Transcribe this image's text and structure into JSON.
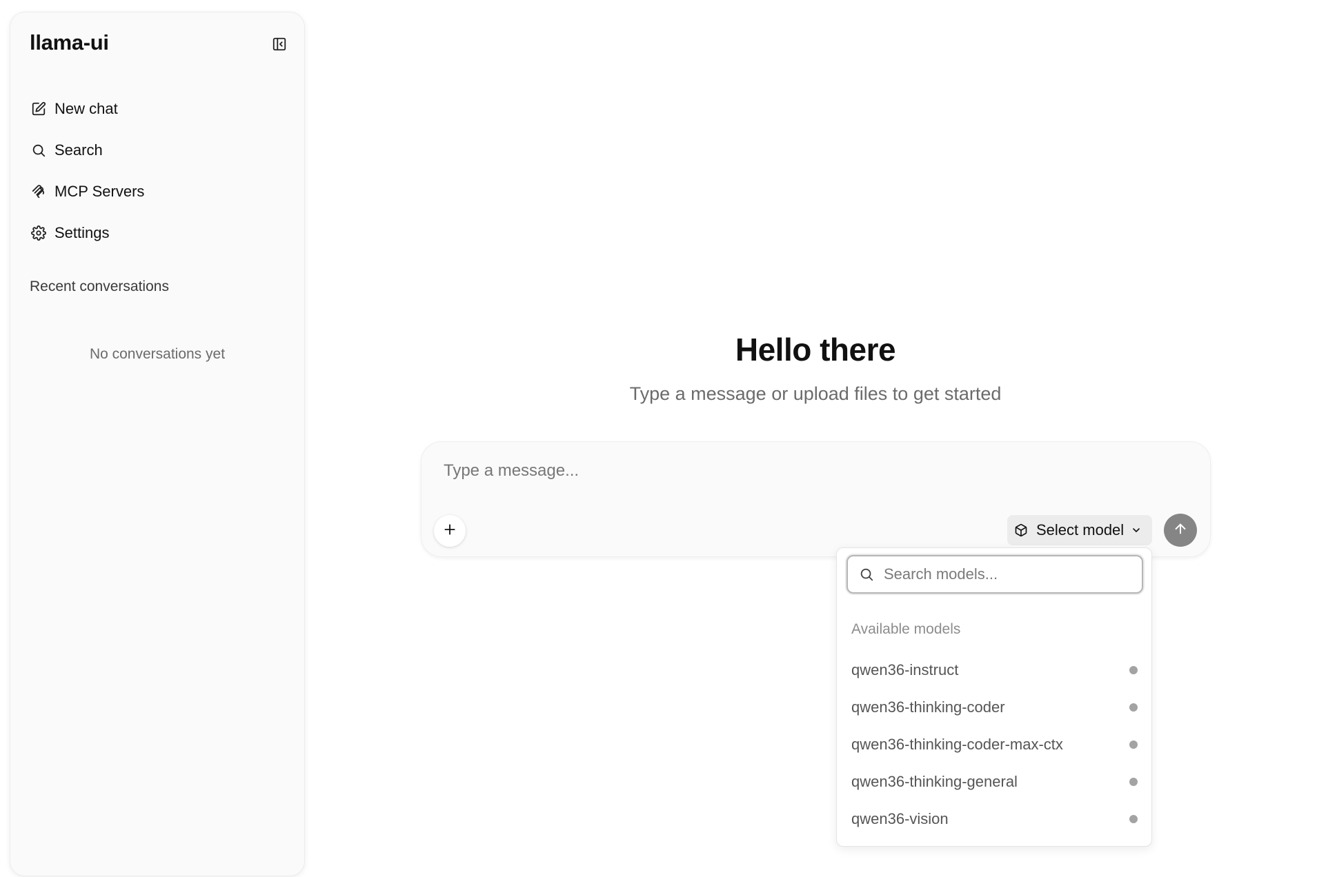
{
  "sidebar": {
    "brand": "llama-ui",
    "nav": [
      {
        "label": "New chat",
        "icon": "edit-icon"
      },
      {
        "label": "Search",
        "icon": "search-icon"
      },
      {
        "label": "MCP Servers",
        "icon": "mcp-icon"
      },
      {
        "label": "Settings",
        "icon": "gear-icon"
      }
    ],
    "section_title": "Recent conversations",
    "empty_text": "No conversations yet"
  },
  "main": {
    "title": "Hello there",
    "subtitle": "Type a message or upload files to get started"
  },
  "composer": {
    "placeholder": "Type a message...",
    "model_button_label": "Select model"
  },
  "model_dropdown": {
    "search_placeholder": "Search models...",
    "section_title": "Available models",
    "models": [
      "qwen36-instruct",
      "qwen36-thinking-coder",
      "qwen36-thinking-coder-max-ctx",
      "qwen36-thinking-general",
      "qwen36-vision"
    ]
  },
  "colors": {
    "sidebar_bg": "#fafafa",
    "send_button": "#858585",
    "status_dot": "#a3a3a3"
  }
}
